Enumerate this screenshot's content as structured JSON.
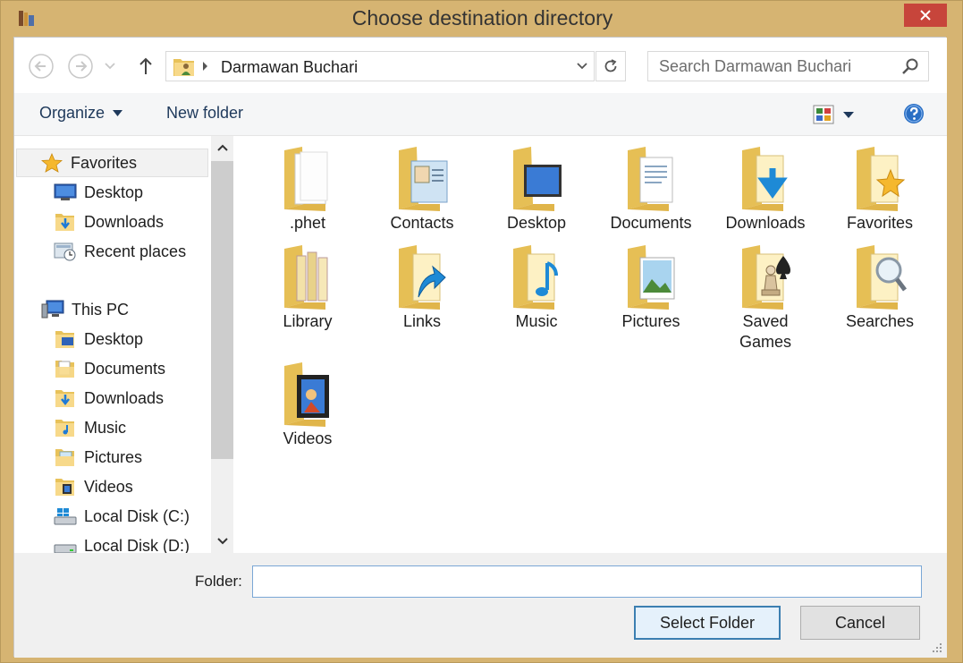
{
  "window": {
    "title": "Choose destination directory"
  },
  "nav": {
    "address_path": "Darmawan Buchari",
    "search_placeholder": "Search Darmawan Buchari"
  },
  "toolbar": {
    "organize_label": "Organize",
    "new_folder_label": "New folder"
  },
  "sidebar": {
    "items": [
      {
        "label": "Favorites",
        "icon": "star-icon"
      },
      {
        "label": "Desktop",
        "icon": "desktop-icon"
      },
      {
        "label": "Downloads",
        "icon": "downloads-folder-icon"
      },
      {
        "label": "Recent places",
        "icon": "recent-places-icon"
      },
      {
        "label": "This PC",
        "icon": "pc-icon"
      },
      {
        "label": "Desktop",
        "icon": "desktop-folder-icon"
      },
      {
        "label": "Documents",
        "icon": "documents-folder-icon"
      },
      {
        "label": "Downloads",
        "icon": "downloads-folder-icon"
      },
      {
        "label": "Music",
        "icon": "music-folder-icon"
      },
      {
        "label": "Pictures",
        "icon": "pictures-folder-icon"
      },
      {
        "label": "Videos",
        "icon": "videos-folder-icon"
      },
      {
        "label": "Local Disk (C:)",
        "icon": "windows-drive-icon"
      },
      {
        "label": "Local Disk (D:)",
        "icon": "drive-icon"
      }
    ]
  },
  "folders": [
    {
      "line1": ".phet",
      "line2": "",
      "icon": "blank-folder-icon"
    },
    {
      "line1": "Contacts",
      "line2": "",
      "icon": "contacts-folder-icon"
    },
    {
      "line1": "Desktop",
      "line2": "",
      "icon": "desktop-folder-icon"
    },
    {
      "line1": "Documents",
      "line2": "",
      "icon": "documents-folder-icon"
    },
    {
      "line1": "Downloads",
      "line2": "",
      "icon": "downloads-folder-icon"
    },
    {
      "line1": "Favorites",
      "line2": "",
      "icon": "favorites-folder-icon"
    },
    {
      "line1": "Library",
      "line2": "",
      "icon": "library-folder-icon"
    },
    {
      "line1": "Links",
      "line2": "",
      "icon": "links-folder-icon"
    },
    {
      "line1": "Music",
      "line2": "",
      "icon": "music-folder-icon"
    },
    {
      "line1": "Pictures",
      "line2": "",
      "icon": "pictures-folder-icon"
    },
    {
      "line1": "Saved",
      "line2": "Games",
      "icon": "saved-games-folder-icon"
    },
    {
      "line1": "Searches",
      "line2": "",
      "icon": "searches-folder-icon"
    },
    {
      "line1": "Videos",
      "line2": "",
      "icon": "videos-folder-icon"
    }
  ],
  "footer": {
    "folder_label": "Folder:",
    "folder_value": "",
    "select_label": "Select Folder",
    "cancel_label": "Cancel"
  },
  "colors": {
    "frame": "#d6b472",
    "close": "#c7453b",
    "accent": "#3c7fb1",
    "folder": "#f5d77f"
  }
}
